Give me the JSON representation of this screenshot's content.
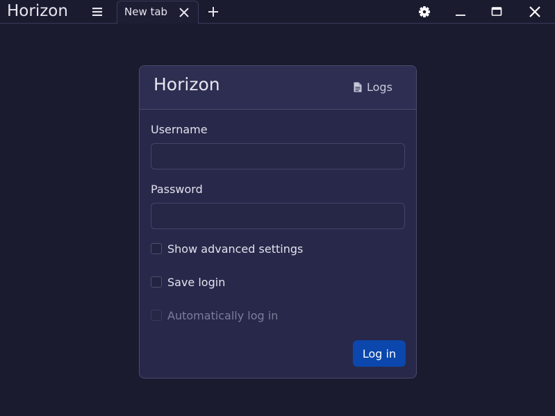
{
  "titlebar": {
    "app_title": "Horizon",
    "tabs": [
      {
        "label": "New tab",
        "active": true
      }
    ]
  },
  "icons": {
    "menu": "hamburger-menu-icon",
    "tab_close": "close-icon",
    "new_tab": "plus-icon",
    "settings": "gear-icon",
    "minimize": "minimize-icon",
    "maximize": "maximize-icon",
    "close": "close-icon",
    "logs": "document-icon"
  },
  "login": {
    "title": "Horizon",
    "logs_label": "Logs",
    "username_label": "Username",
    "username_value": "",
    "password_label": "Password",
    "password_value": "",
    "checkboxes": [
      {
        "label": "Show advanced settings",
        "checked": false,
        "disabled": false
      },
      {
        "label": "Save login",
        "checked": false,
        "disabled": false
      },
      {
        "label": "Automatically log in",
        "checked": false,
        "disabled": true
      }
    ],
    "submit_label": "Log in"
  },
  "colors": {
    "background": "#1b1b30",
    "card": "#28284a",
    "accent": "#0b47ad",
    "text": "#e2e2ee",
    "disabled_text": "#7c7c9a"
  }
}
